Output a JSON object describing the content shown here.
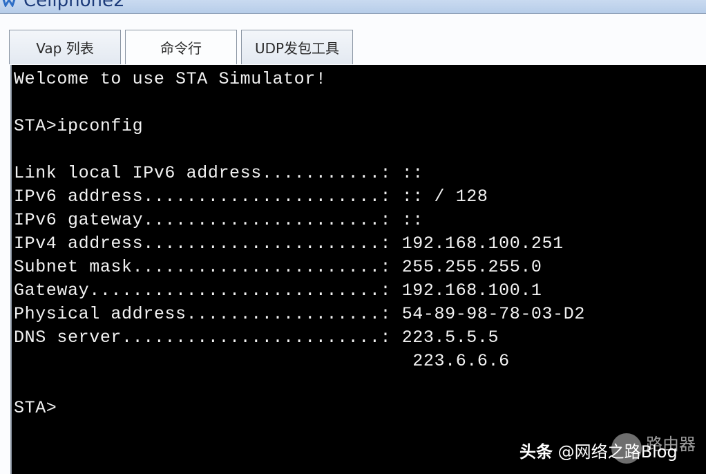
{
  "window": {
    "title": "Cellphone2",
    "icon": "app-icon"
  },
  "tabs": [
    {
      "label": "Vap 列表",
      "active": false
    },
    {
      "label": "命令行",
      "active": true
    },
    {
      "label": "UDP发包工具",
      "active": false
    }
  ],
  "terminal": {
    "lines": [
      "Welcome to use STA Simulator!",
      "",
      "STA>ipconfig",
      "",
      "Link local IPv6 address...........: ::",
      "IPv6 address......................: :: / 128",
      "IPv6 gateway......................: ::",
      "IPv4 address......................: 192.168.100.251",
      "Subnet mask.......................: 255.255.255.0",
      "Gateway...........................: 192.168.100.1",
      "Physical address..................: 54-89-98-78-03-D2",
      "DNS server........................: 223.5.5.5",
      "                                     223.6.6.6",
      "",
      "STA>"
    ],
    "prompt": "STA>"
  },
  "watermark": {
    "source": "头条",
    "handle": "@网络之路Blog",
    "site": "路由器"
  }
}
